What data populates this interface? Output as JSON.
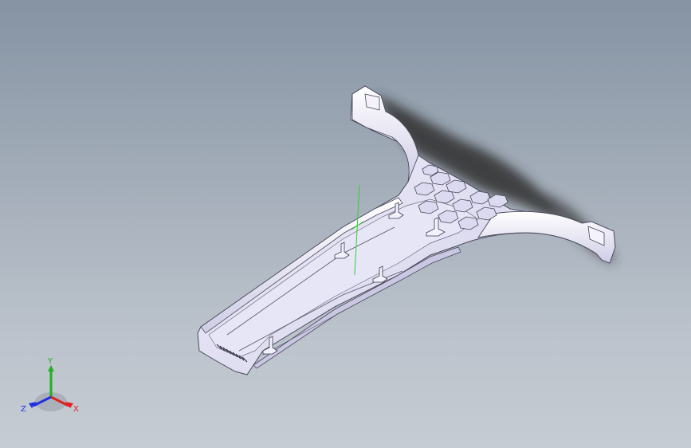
{
  "viewport": {
    "background_top": "#8593a3",
    "background_bottom": "#c6ccd3"
  },
  "model": {
    "part_color": "#e4e3f4",
    "edge_color": "#4a4a5c",
    "shadow_color": "#3a3a3a",
    "sketch_line_color": "#2fd12f"
  },
  "triad": {
    "x_label": "X",
    "y_label": "Y",
    "z_label": "Z",
    "x_color": "#e02020",
    "y_color": "#20b020",
    "z_color": "#2030e0"
  }
}
